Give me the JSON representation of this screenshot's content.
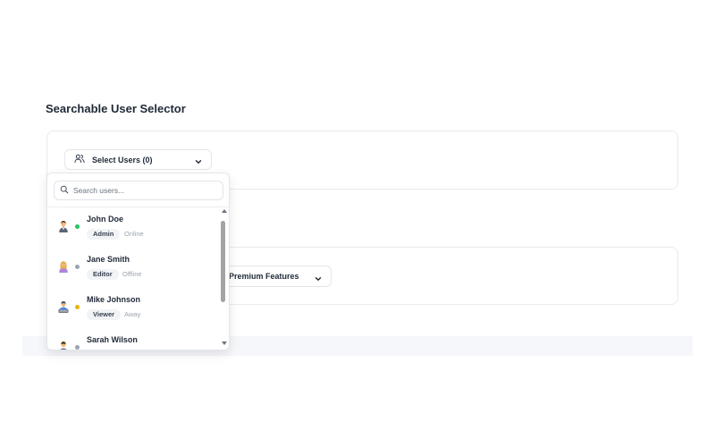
{
  "page": {
    "title": "Searchable User Selector"
  },
  "selector": {
    "label": "Select Users (0)",
    "icon": "users-icon"
  },
  "search": {
    "placeholder": "Search users..."
  },
  "users": [
    {
      "name": "John Doe",
      "role": "Admin",
      "status": "Online",
      "status_color": "#22c55e",
      "avatar": "man-icon"
    },
    {
      "name": "Jane Smith",
      "role": "Editor",
      "status": "Offline",
      "status_color": "#9ca3af",
      "avatar": "woman-icon"
    },
    {
      "name": "Mike Johnson",
      "role": "Viewer",
      "status": "Away",
      "status_color": "#eab308",
      "avatar": "technician-icon"
    },
    {
      "name": "Sarah Wilson",
      "role": "",
      "status": "",
      "status_color": "#9ca3af",
      "avatar": "person-icon"
    }
  ],
  "premium": {
    "label": "Premium Features"
  }
}
